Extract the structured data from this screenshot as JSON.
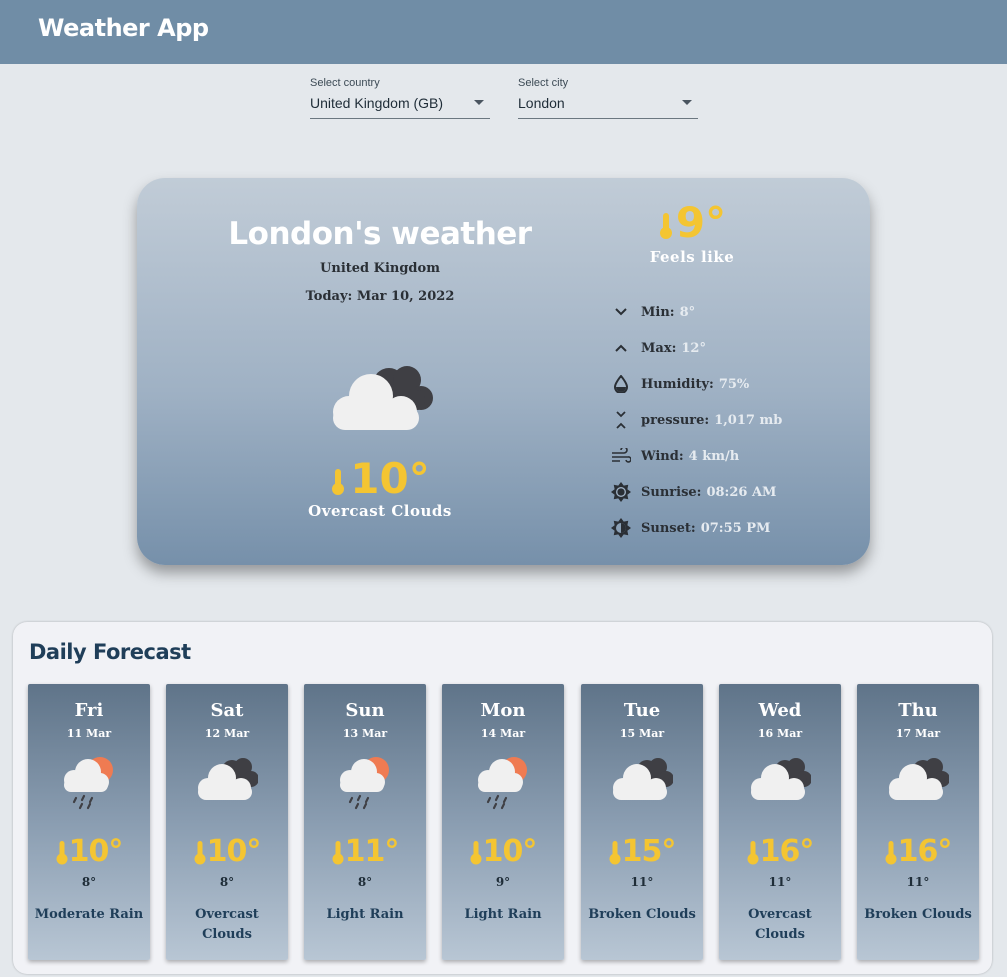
{
  "app": {
    "title": "Weather App"
  },
  "filters": {
    "country": {
      "label": "Select country",
      "value": "United Kingdom (GB)"
    },
    "city": {
      "label": "Select city",
      "value": "London"
    }
  },
  "current": {
    "title": "London's weather",
    "country": "United Kingdom",
    "date": "Today: Mar 10, 2022",
    "temp": "10°",
    "condition": "Overcast Clouds",
    "icon": "overcast-clouds-icon",
    "feels_like": {
      "temp": "9°",
      "label": "Feels like"
    },
    "stats": [
      {
        "icon": "chevron-down-icon",
        "key": "Min:",
        "value": "8°"
      },
      {
        "icon": "chevron-up-icon",
        "key": "Max:",
        "value": "12°"
      },
      {
        "icon": "humidity-drop-icon",
        "key": "Humidity:",
        "value": "75%"
      },
      {
        "icon": "pressure-icon",
        "key": "pressure:",
        "value": "1,017 mb"
      },
      {
        "icon": "wind-icon",
        "key": "Wind:",
        "value": "4 km/h"
      },
      {
        "icon": "sunrise-icon",
        "key": "Sunrise:",
        "value": "08:26 AM"
      },
      {
        "icon": "sunset-icon",
        "key": "Sunset:",
        "value": "07:55 PM"
      }
    ]
  },
  "forecast": {
    "title": "Daily Forecast",
    "days": [
      {
        "day": "Fri",
        "date": "11 Mar",
        "temp": "10°",
        "low": "8°",
        "desc": "Moderate Rain",
        "icon": "rain-sun-icon"
      },
      {
        "day": "Sat",
        "date": "12 Mar",
        "temp": "10°",
        "low": "8°",
        "desc": "Overcast Clouds",
        "icon": "overcast-clouds-icon"
      },
      {
        "day": "Sun",
        "date": "13 Mar",
        "temp": "11°",
        "low": "8°",
        "desc": "Light Rain",
        "icon": "rain-sun-icon"
      },
      {
        "day": "Mon",
        "date": "14 Mar",
        "temp": "10°",
        "low": "9°",
        "desc": "Light Rain",
        "icon": "rain-sun-icon"
      },
      {
        "day": "Tue",
        "date": "15 Mar",
        "temp": "15°",
        "low": "11°",
        "desc": "Broken Clouds",
        "icon": "broken-clouds-icon"
      },
      {
        "day": "Wed",
        "date": "16 Mar",
        "temp": "16°",
        "low": "11°",
        "desc": "Overcast Clouds",
        "icon": "overcast-clouds-icon"
      },
      {
        "day": "Thu",
        "date": "17 Mar",
        "temp": "16°",
        "low": "11°",
        "desc": "Broken Clouds",
        "icon": "broken-clouds-icon"
      }
    ]
  },
  "colors": {
    "appbar": "#708da6",
    "accent_temp": "#f4c532",
    "forecast_title": "#1f3e59",
    "sun": "#ef7b52"
  }
}
